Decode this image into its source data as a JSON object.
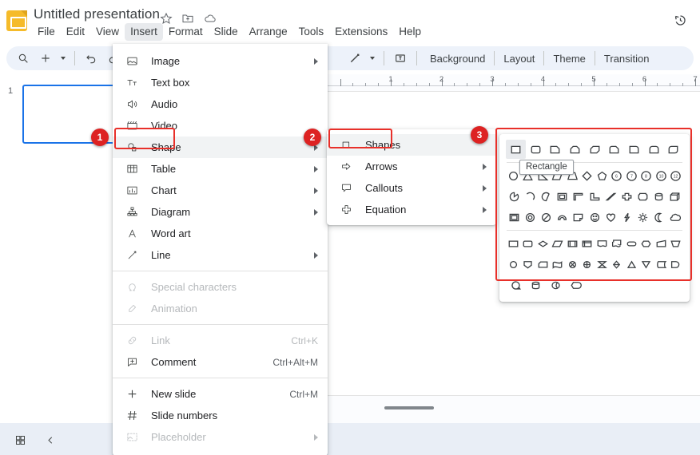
{
  "app": {
    "title": "Untitled presentation",
    "logo_icon": "slides-logo-icon",
    "title_icons": [
      "star-icon",
      "move-to-folder-icon",
      "cloud-saved-icon"
    ],
    "history_icon": "version-history-icon"
  },
  "menubar": {
    "items": [
      {
        "label": "File",
        "active": false
      },
      {
        "label": "Edit",
        "active": false
      },
      {
        "label": "View",
        "active": false
      },
      {
        "label": "Insert",
        "active": true
      },
      {
        "label": "Format",
        "active": false
      },
      {
        "label": "Slide",
        "active": false
      },
      {
        "label": "Arrange",
        "active": false
      },
      {
        "label": "Tools",
        "active": false
      },
      {
        "label": "Extensions",
        "active": false
      },
      {
        "label": "Help",
        "active": false
      }
    ]
  },
  "toolbar": {
    "search_icon": "search-icon",
    "new_slide_icon": "plus-icon",
    "new_slide_caret": "chevron-down-icon",
    "undo_icon": "undo-icon",
    "redo_icon": "redo-icon",
    "line_icon": "line-icon",
    "line_caret": "chevron-down-icon",
    "textbox_icon": "text-box-icon",
    "background_label": "Background",
    "layout_label": "Layout",
    "theme_label": "Theme",
    "transition_label": "Transition"
  },
  "filmstrip": {
    "slide_number": "1"
  },
  "ruler": {
    "labels": [
      "1",
      "2",
      "3",
      "4",
      "5",
      "6",
      "7"
    ]
  },
  "insert_menu": {
    "groups": [
      {
        "items": [
          {
            "label": "Image",
            "icon": "image-icon",
            "submenu": true,
            "accel": "",
            "disabled": false,
            "highlight": false
          },
          {
            "label": "Text box",
            "icon": "text-box-icon",
            "submenu": false,
            "accel": "",
            "disabled": false,
            "highlight": false
          },
          {
            "label": "Audio",
            "icon": "audio-icon",
            "submenu": false,
            "accel": "",
            "disabled": false,
            "highlight": false
          },
          {
            "label": "Video",
            "icon": "video-icon",
            "submenu": false,
            "accel": "",
            "disabled": false,
            "highlight": false
          },
          {
            "label": "Shape",
            "icon": "shape-icon",
            "submenu": true,
            "accel": "",
            "disabled": false,
            "highlight": true
          },
          {
            "label": "Table",
            "icon": "table-icon",
            "submenu": true,
            "accel": "",
            "disabled": false,
            "highlight": false
          },
          {
            "label": "Chart",
            "icon": "chart-icon",
            "submenu": true,
            "accel": "",
            "disabled": false,
            "highlight": false
          },
          {
            "label": "Diagram",
            "icon": "diagram-icon",
            "submenu": true,
            "accel": "",
            "disabled": false,
            "highlight": false
          },
          {
            "label": "Word art",
            "icon": "word-art-icon",
            "submenu": false,
            "accel": "",
            "disabled": false,
            "highlight": false
          },
          {
            "label": "Line",
            "icon": "line-icon",
            "submenu": true,
            "accel": "",
            "disabled": false,
            "highlight": false
          }
        ]
      },
      {
        "items": [
          {
            "label": "Special characters",
            "icon": "omega-icon",
            "submenu": false,
            "accel": "",
            "disabled": true,
            "highlight": false
          },
          {
            "label": "Animation",
            "icon": "animation-icon",
            "submenu": false,
            "accel": "",
            "disabled": true,
            "highlight": false
          }
        ]
      },
      {
        "items": [
          {
            "label": "Link",
            "icon": "link-icon",
            "submenu": false,
            "accel": "Ctrl+K",
            "disabled": true,
            "highlight": false
          },
          {
            "label": "Comment",
            "icon": "comment-icon",
            "submenu": false,
            "accel": "Ctrl+Alt+M",
            "disabled": false,
            "highlight": false
          }
        ]
      },
      {
        "items": [
          {
            "label": "New slide",
            "icon": "plus-icon",
            "submenu": false,
            "accel": "Ctrl+M",
            "disabled": false,
            "highlight": false
          },
          {
            "label": "Slide numbers",
            "icon": "hash-icon",
            "submenu": false,
            "accel": "",
            "disabled": false,
            "highlight": false
          },
          {
            "label": "Placeholder",
            "icon": "placeholder-icon",
            "submenu": true,
            "accel": "",
            "disabled": true,
            "highlight": false
          }
        ]
      }
    ]
  },
  "shape_submenu": {
    "items": [
      {
        "label": "Shapes",
        "icon": "square-icon",
        "submenu": true,
        "highlight": true
      },
      {
        "label": "Arrows",
        "icon": "arrow-right-icon",
        "submenu": true,
        "highlight": false
      },
      {
        "label": "Callouts",
        "icon": "callout-icon",
        "submenu": true,
        "highlight": false
      },
      {
        "label": "Equation",
        "icon": "plus-shape-icon",
        "submenu": true,
        "highlight": false
      }
    ]
  },
  "shapes_palette": {
    "tooltip": "Rectangle",
    "rows": [
      [
        "rectangle",
        "rounded-rectangle",
        "snip-single-corner-rectangle",
        "snip-same-side-corner-rectangle",
        "snip-diagonal-corner-rectangle",
        "snip-and-round-single-corner-rectangle",
        "round-single-corner-rectangle",
        "round-same-side-corner-rectangle",
        "round-diagonal-corner-rectangle"
      ],
      [
        "ellipse",
        "triangle",
        "right-triangle",
        "parallelogram",
        "trapezoid",
        "diamond",
        "pentagon",
        "hexagon",
        "heptagon",
        "octagon",
        "decagon",
        "dodecagon"
      ],
      [
        "pie",
        "chord",
        "teardrop",
        "frame",
        "half-frame",
        "l-shape",
        "diagonal-stripe",
        "cross",
        "plaque",
        "can",
        "cube"
      ],
      [
        "bevel",
        "donut",
        "no-symbol",
        "block-arc",
        "folded-corner",
        "smiley-face",
        "heart",
        "lightning-bolt",
        "sun",
        "moon",
        "cloud"
      ],
      [
        "flowchart-process",
        "flowchart-alternate-process",
        "flowchart-decision",
        "flowchart-data",
        "flowchart-predefined-process",
        "flowchart-internal-storage",
        "flowchart-document",
        "flowchart-multidocument",
        "flowchart-terminator",
        "flowchart-preparation",
        "flowchart-manual-input",
        "flowchart-manual-operation"
      ],
      [
        "flowchart-connector",
        "flowchart-off-page-connector",
        "flowchart-card",
        "flowchart-punched-tape",
        "flowchart-summing-junction",
        "flowchart-or",
        "flowchart-collate",
        "flowchart-sort",
        "flowchart-extract",
        "flowchart-merge",
        "flowchart-stored-data",
        "flowchart-delay"
      ],
      [
        "flowchart-sequential-access-storage",
        "flowchart-magnetic-disk",
        "flowchart-direct-access-storage",
        "flowchart-display"
      ]
    ]
  },
  "annotations": [
    {
      "id": "1",
      "target": "insert-menu-shape-row"
    },
    {
      "id": "2",
      "target": "shape-submenu-shapes-row"
    },
    {
      "id": "3",
      "target": "shapes-palette"
    }
  ]
}
